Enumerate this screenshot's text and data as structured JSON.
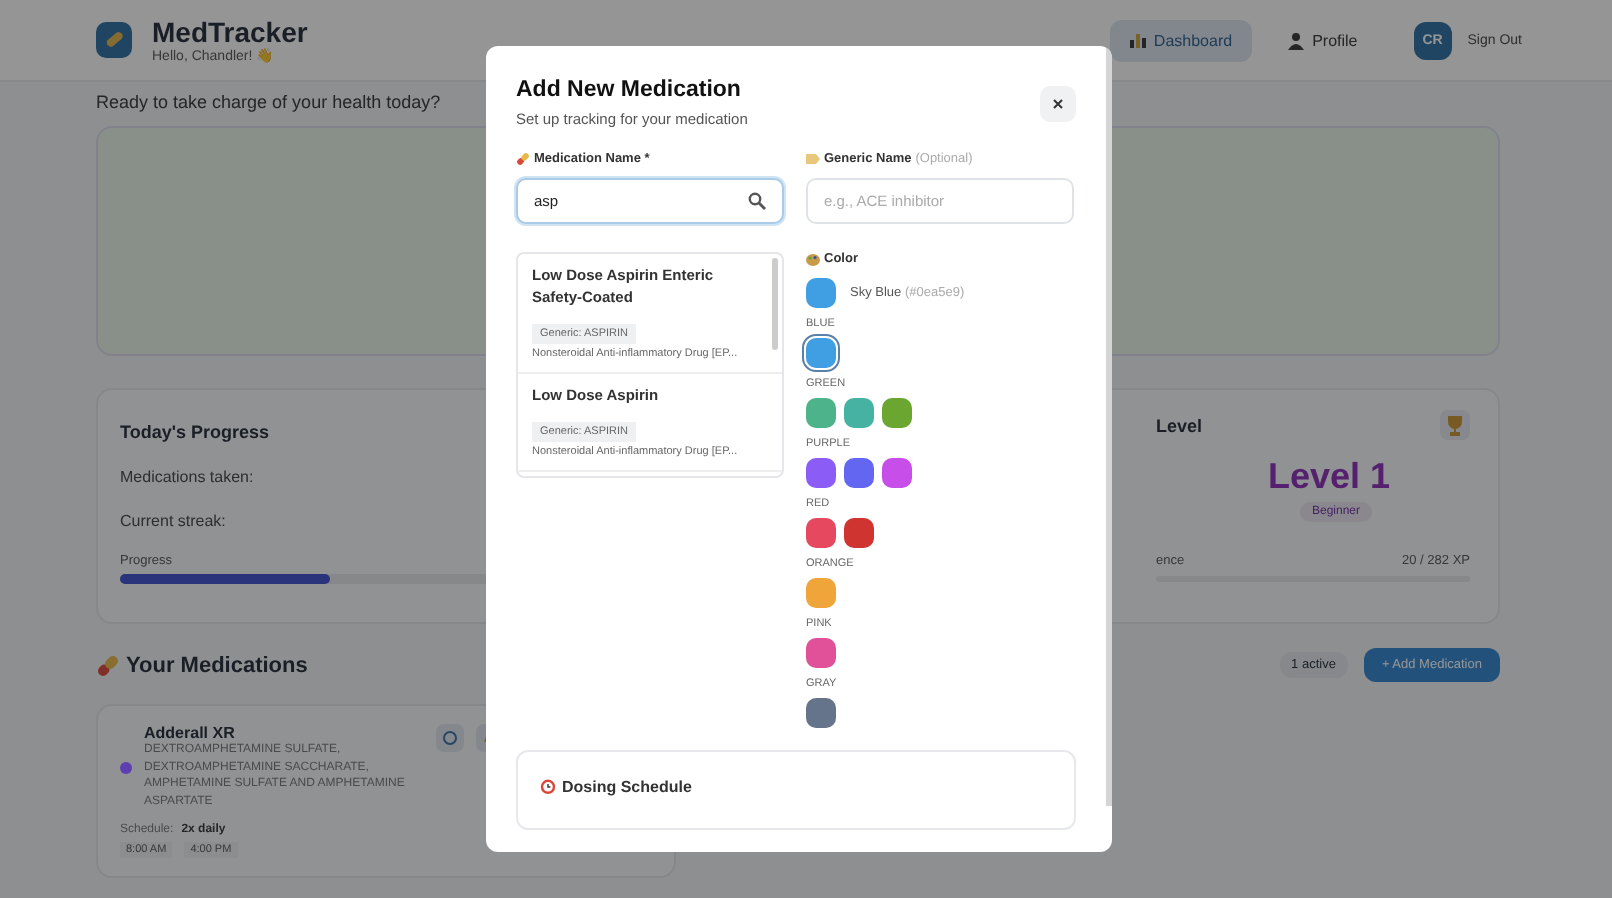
{
  "header": {
    "app_name": "MedTracker",
    "greeting": "Hello, Chandler! 👋",
    "nav": [
      {
        "label": "Dashboard",
        "selected": true,
        "kind": "chart"
      },
      {
        "label": "Profile",
        "selected": false,
        "kind": "person"
      }
    ],
    "avatar": "CR",
    "sign_out": "Sign Out"
  },
  "welcome": "Ready to take charge of your health today?",
  "progress_card": {
    "title": "Today's Progress",
    "rows": [
      "Medications taken:",
      "Current streak:"
    ],
    "progress_label": "Progress",
    "level": 0.33
  },
  "level_card": {
    "title": "Level",
    "level_name": "Level 1",
    "badge": "Beginner",
    "xp_label": "ence",
    "xp": "20 / 282 XP"
  },
  "medications": {
    "title": "Your Medications",
    "count": "1 active",
    "add_button": "+ Add Medication",
    "items": [
      {
        "name": "Adderall XR",
        "generic": "DEXTROAMPHETAMINE SULFATE, DEXTROAMPHETAMINE SACCHARATE, AMPHETAMINE SULFATE AND AMPHETAMINE ASPARTATE",
        "color": "#5e3fb2",
        "schedule_label": "Schedule:",
        "schedule": "2x daily",
        "times": [
          "8:00 AM",
          "4:00 PM"
        ]
      }
    ]
  },
  "modal": {
    "title": "Add New Medication",
    "subtitle": "Set up tracking for your medication",
    "name_label": "Medication Name *",
    "name_value": "asp",
    "generic_label": "Generic Name",
    "generic_optional": "(Optional)",
    "generic_placeholder": "e.g., ACE inhibitor",
    "suggestions": [
      {
        "name": "Low Dose Aspirin Enteric Safety-Coated",
        "generic": "Generic: ASPIRIN",
        "class": "Nonsteroidal Anti-inflammatory Drug [EP..."
      },
      {
        "name": "Low Dose Aspirin",
        "generic": "Generic: ASPIRIN",
        "class": "Nonsteroidal Anti-inflammatory Drug [EP..."
      }
    ],
    "color_label": "Color",
    "chosen_name": "Sky Blue",
    "chosen_code": "(#0ea5e9)",
    "palette": [
      {
        "group": "BLUE",
        "swatches": [
          {
            "color": "#3f9fe2",
            "selected": true
          }
        ]
      },
      {
        "group": "GREEN",
        "swatches": [
          {
            "color": "#4cb38a",
            "selected": false
          },
          {
            "color": "#45b2a2",
            "selected": false
          },
          {
            "color": "#6aa630",
            "selected": false
          }
        ]
      },
      {
        "group": "PURPLE",
        "swatches": [
          {
            "color": "#8b5cf6",
            "selected": false
          },
          {
            "color": "#6366f1",
            "selected": false
          },
          {
            "color": "#c74ee8",
            "selected": false
          }
        ]
      },
      {
        "group": "RED",
        "swatches": [
          {
            "color": "#e5485f",
            "selected": false
          },
          {
            "color": "#cf3430",
            "selected": false
          }
        ]
      },
      {
        "group": "ORANGE",
        "swatches": [
          {
            "color": "#f0a53a",
            "selected": false
          }
        ]
      },
      {
        "group": "PINK",
        "swatches": [
          {
            "color": "#e0519a",
            "selected": false
          }
        ]
      },
      {
        "group": "GRAY",
        "swatches": [
          {
            "color": "#66748b",
            "selected": false
          }
        ]
      }
    ],
    "schedule_title": "Dosing Schedule"
  }
}
